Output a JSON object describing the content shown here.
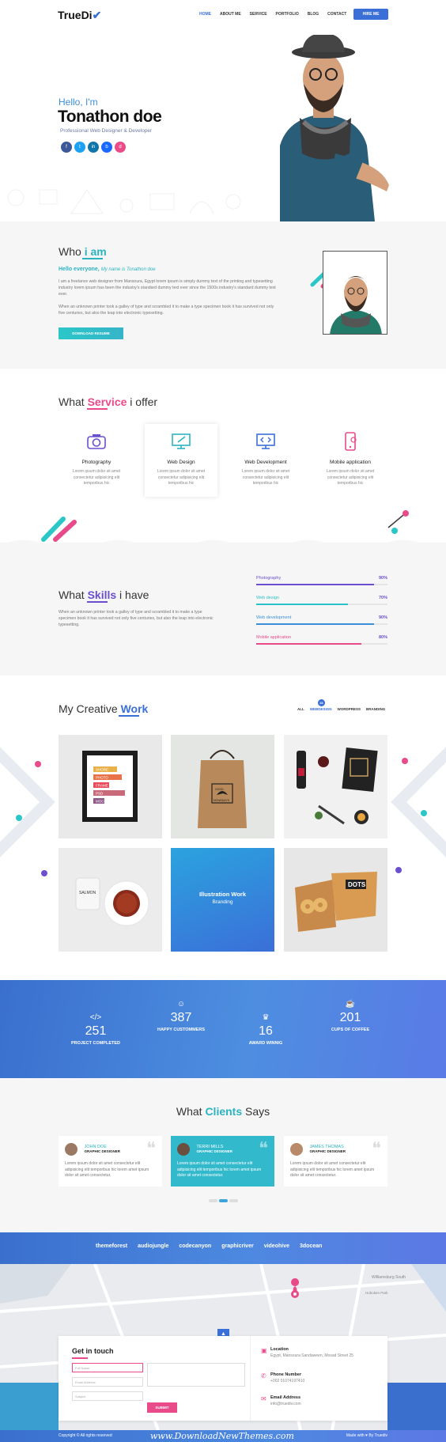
{
  "nav": {
    "logo": "TrueDi",
    "logo_tick": "✔",
    "links": [
      "HOME",
      "ABOUT ME",
      "SERVICE",
      "PORTFOLIO",
      "BLOG",
      "CONTACT"
    ],
    "active": "HOME",
    "hire": "HIRE ME"
  },
  "hero": {
    "hello": "Hello, I'm",
    "name": "Tonathon doe",
    "subtitle": "Professional Web Designer & Developer",
    "socials": [
      "f",
      "t",
      "in",
      "b",
      "d"
    ]
  },
  "about": {
    "title_a": "Who ",
    "title_b": "i am",
    "hello": "Hello everyone, ",
    "hello_i": "My name is Tonathon doe",
    "p1": "I am a freelance web designer from Mansoura, Egypt lorem ipsum is simply dummy text of the printing and typesetting industry lorem ipsum has been the industry's standard dummy text ever since the 1500s industry's standard dummy text ever.",
    "p2": "When an unknown printer took a galley of type and scrambled it to make a type specimen book it has survived not only five centuries, but also the leap into electronic typesetting.",
    "button": "DOWNLOAD RESUME"
  },
  "services": {
    "title_a": "What ",
    "title_b": "Service",
    "title_c": " i offer",
    "items": [
      {
        "title": "Photography",
        "desc": "Lorem ipsum dolor sit amet consectetur adipisicing elit temporibus hic"
      },
      {
        "title": "Web Design",
        "desc": "Lorem ipsum dolor sit amet consectetur adipisicing elit temporibus hic"
      },
      {
        "title": "Web Development",
        "desc": "Lorem ipsum dolor sit amet consectetur adipisicing elit temporibus hic"
      },
      {
        "title": "Mobile application",
        "desc": "Lorem ipsum dolor sit amet consectetur adipisicing elit temporibus hic"
      }
    ]
  },
  "skills": {
    "title_a": "What ",
    "title_b": "Skills",
    "title_c": " i have",
    "desc": "When an unknown printer took a galley of type and scrambled it to make a type specimen book it has survived not only five centuries, but also the leap into electronic typesetting.",
    "bars": [
      {
        "name": "Photography",
        "value": "90%",
        "fraction": 0.9,
        "color": "#6b4fcf"
      },
      {
        "name": "Web design",
        "value": "70%",
        "fraction": 0.7,
        "color": "#2bc1c8"
      },
      {
        "name": "Web development",
        "value": "90%",
        "fraction": 0.9,
        "color": "#3b8fd8"
      },
      {
        "name": "Mobile application",
        "value": "80%",
        "fraction": 0.8,
        "color": "#e84a8a"
      }
    ]
  },
  "work": {
    "title_a": "My Creative ",
    "title_b": "Work",
    "filters": [
      "ALL",
      "WEBDESIGN",
      "WORDPRESS",
      "BRANDING"
    ],
    "active_filter": "WEBDESIGN",
    "badge": "15",
    "frame_text": [
      "SHORE",
      "PHOTO",
      "FRAME",
      "PSD",
      "MOCKUP"
    ],
    "bag_text": [
      "GOOD",
      "NOWADAYS"
    ],
    "overlay_title": "Illustration Work",
    "overlay_sub": "Branding",
    "tin_text": "SALMON",
    "dots_text": "DOTS"
  },
  "stats": [
    {
      "num": "251",
      "label": "PROJECT COMPLETED",
      "icon": "</>"
    },
    {
      "num": "387",
      "label": "HAPPY CUSTOMMERS",
      "icon": "☺"
    },
    {
      "num": "16",
      "label": "AWARD WINNIG",
      "icon": "♛"
    },
    {
      "num": "201",
      "label": "CUPS OF COFFEE",
      "icon": "☕"
    }
  ],
  "clients": {
    "title_a": "What ",
    "title_b": "Clients",
    "title_c": " Says",
    "items": [
      {
        "name": "JOHN DOE",
        "role": "GRAPHIC DESIGNER",
        "text": "Lorem ipsum dolor sit amet consectetur elit adipisicing elit temporibus hic lorem amet ipsum dolor sit amet consectetur."
      },
      {
        "name": "TERRI MILLS",
        "role": "GRAPHIC DESIGNER",
        "text": "Lorem ipsum dolor sit amet consectetur elit adipisicing elit temporibus hic lorem amet ipsum dolor sit amet consectetur."
      },
      {
        "name": "JAMES THOMAS",
        "role": "GRAPHIC DESIGNER",
        "text": "Lorem ipsum dolor sit amet consectetur elit adipisicing elit temporibus hic lorem amet ipsum dolor sit amet consectetur."
      }
    ],
    "quote_mark": "❝"
  },
  "brands": [
    "themeforest",
    "audiojungle",
    "codecanyon",
    "graphicriver",
    "videohive",
    "3docean"
  ],
  "contact": {
    "title": "Get in touch",
    "fields": {
      "name": "Full Name",
      "email": "Email Address",
      "subject": "Subject",
      "message": ""
    },
    "submit": "SUBMIT",
    "up": "▲",
    "map_label": "Williamsburg South",
    "map_label2": "Hoboken Park",
    "info": [
      {
        "title": "Location",
        "value": "Egypt, Mansoura Sandaween, Mosad Street 25",
        "icon": "▣"
      },
      {
        "title": "Phone Number",
        "value": "+002 01074197410",
        "icon": "✆"
      },
      {
        "title": "Email Address",
        "value": "info@truediv.com",
        "icon": "✉"
      }
    ]
  },
  "footer": {
    "copy": "Copyright © All rights reserved",
    "watermark": "www.DownloadNewThemes.com",
    "made": "Made with ♥ By Truediv"
  }
}
